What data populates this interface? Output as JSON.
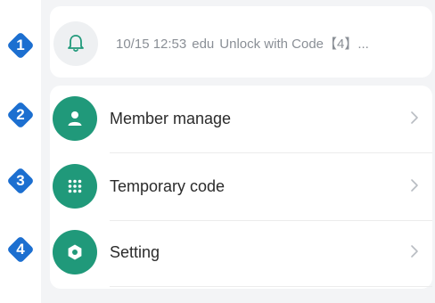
{
  "notification": {
    "icon": "bell-icon",
    "timestamp": "10/15 12:53",
    "user": "edu",
    "message": "Unlock with Code【4】..."
  },
  "menu": {
    "items": [
      {
        "label": "Member manage",
        "icon": "person-icon"
      },
      {
        "label": "Temporary code",
        "icon": "keypad-icon"
      },
      {
        "label": "Setting",
        "icon": "gear-icon"
      }
    ]
  },
  "markers": [
    "1",
    "2",
    "3",
    "4"
  ],
  "colors": {
    "accent": "#20997a",
    "marker": "#1c6fd0",
    "background": "#f3f4f6"
  }
}
